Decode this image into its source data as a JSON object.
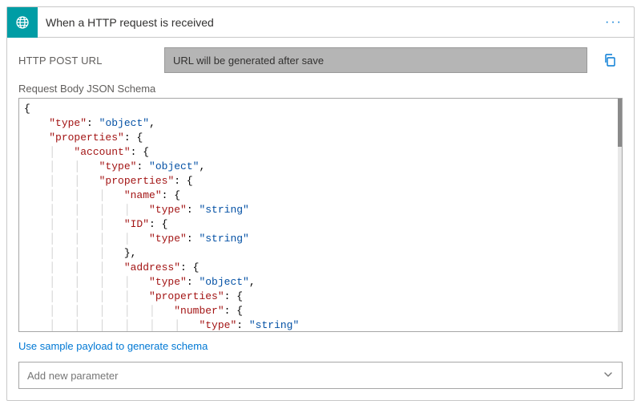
{
  "card": {
    "title": "When a HTTP request is received",
    "url_label": "HTTP POST URL",
    "url_placeholder": "URL will be generated after save",
    "schema_label": "Request Body JSON Schema",
    "sample_link": "Use sample payload to generate schema",
    "add_param_placeholder": "Add new parameter"
  },
  "schema_lines": [
    [
      {
        "t": "brace",
        "v": "{"
      }
    ],
    [
      {
        "t": "guide",
        "v": "    "
      },
      {
        "t": "key",
        "v": "\"type\""
      },
      {
        "t": "colon",
        "v": ": "
      },
      {
        "t": "str",
        "v": "\"object\""
      },
      {
        "t": "plain",
        "v": ","
      }
    ],
    [
      {
        "t": "guide",
        "v": "    "
      },
      {
        "t": "key",
        "v": "\"properties\""
      },
      {
        "t": "colon",
        "v": ": "
      },
      {
        "t": "brace",
        "v": "{"
      }
    ],
    [
      {
        "t": "guide",
        "v": "    │   "
      },
      {
        "t": "key",
        "v": "\"account\""
      },
      {
        "t": "colon",
        "v": ": "
      },
      {
        "t": "brace",
        "v": "{"
      }
    ],
    [
      {
        "t": "guide",
        "v": "    │   │   "
      },
      {
        "t": "key",
        "v": "\"type\""
      },
      {
        "t": "colon",
        "v": ": "
      },
      {
        "t": "str",
        "v": "\"object\""
      },
      {
        "t": "plain",
        "v": ","
      }
    ],
    [
      {
        "t": "guide",
        "v": "    │   │   "
      },
      {
        "t": "key",
        "v": "\"properties\""
      },
      {
        "t": "colon",
        "v": ": "
      },
      {
        "t": "brace",
        "v": "{"
      }
    ],
    [
      {
        "t": "guide",
        "v": "    │   │   │   "
      },
      {
        "t": "key",
        "v": "\"name\""
      },
      {
        "t": "colon",
        "v": ": "
      },
      {
        "t": "brace",
        "v": "{"
      }
    ],
    [
      {
        "t": "guide",
        "v": "    │   │   │   │   "
      },
      {
        "t": "key",
        "v": "\"type\""
      },
      {
        "t": "colon",
        "v": ": "
      },
      {
        "t": "str",
        "v": "\"string\""
      }
    ],
    [
      {
        "t": "guide",
        "v": "    │   │   │   "
      },
      {
        "t": "key",
        "v": "\"ID\""
      },
      {
        "t": "colon",
        "v": ": "
      },
      {
        "t": "brace",
        "v": "{"
      }
    ],
    [
      {
        "t": "guide",
        "v": "    │   │   │   │   "
      },
      {
        "t": "key",
        "v": "\"type\""
      },
      {
        "t": "colon",
        "v": ": "
      },
      {
        "t": "str",
        "v": "\"string\""
      }
    ],
    [
      {
        "t": "guide",
        "v": "    │   │   │   "
      },
      {
        "t": "brace",
        "v": "},"
      }
    ],
    [
      {
        "t": "guide",
        "v": "    │   │   │   "
      },
      {
        "t": "key",
        "v": "\"address\""
      },
      {
        "t": "colon",
        "v": ": "
      },
      {
        "t": "brace",
        "v": "{"
      }
    ],
    [
      {
        "t": "guide",
        "v": "    │   │   │   │   "
      },
      {
        "t": "key",
        "v": "\"type\""
      },
      {
        "t": "colon",
        "v": ": "
      },
      {
        "t": "str",
        "v": "\"object\""
      },
      {
        "t": "plain",
        "v": ","
      }
    ],
    [
      {
        "t": "guide",
        "v": "    │   │   │   │   "
      },
      {
        "t": "key",
        "v": "\"properties\""
      },
      {
        "t": "colon",
        "v": ": "
      },
      {
        "t": "brace",
        "v": "{"
      }
    ],
    [
      {
        "t": "guide",
        "v": "    │   │   │   │   │   "
      },
      {
        "t": "key",
        "v": "\"number\""
      },
      {
        "t": "colon",
        "v": ": "
      },
      {
        "t": "brace",
        "v": "{"
      }
    ],
    [
      {
        "t": "guide",
        "v": "    │   │   │   │   │   │   "
      },
      {
        "t": "key",
        "v": "\"type\""
      },
      {
        "t": "colon",
        "v": ": "
      },
      {
        "t": "str",
        "v": "\"string\""
      }
    ]
  ]
}
